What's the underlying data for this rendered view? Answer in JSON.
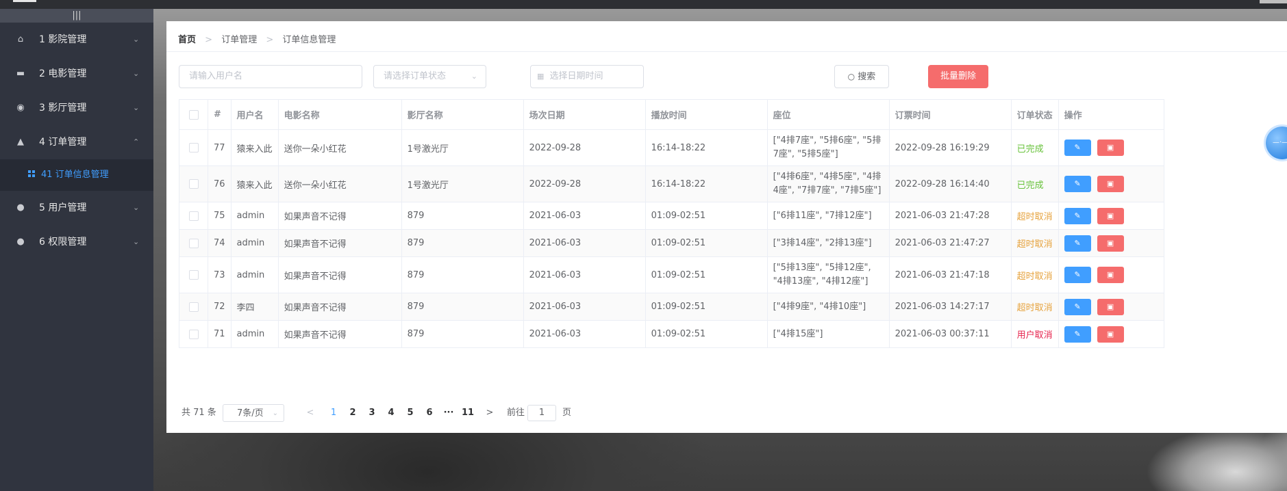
{
  "sidebar": {
    "collapse_icon": "|||",
    "items": [
      {
        "label": "1 影院管理",
        "icon": "home-icon",
        "glyph": "⌂",
        "chevron": "⌄"
      },
      {
        "label": "2 电影管理",
        "icon": "film-truck-icon",
        "glyph": "▬",
        "chevron": "⌄"
      },
      {
        "label": "3 影厅管理",
        "icon": "target-icon",
        "glyph": "◉",
        "chevron": "⌄"
      },
      {
        "label": "4 订单管理",
        "icon": "bell-icon",
        "glyph": "▲",
        "chevron": "⌃"
      },
      {
        "label": "5 用户管理",
        "icon": "user-icon",
        "glyph": "●",
        "chevron": "⌄"
      },
      {
        "label": "6 权限管理",
        "icon": "user-icon",
        "glyph": "●",
        "chevron": "⌄"
      }
    ],
    "submenu": {
      "label": "41 订单信息管理",
      "icon": "grid-icon"
    }
  },
  "breadcrumb": {
    "home": "首页",
    "sep": ">",
    "level1": "订单管理",
    "level2": "订单信息管理"
  },
  "filters": {
    "username_placeholder": "请输入用户名",
    "status_placeholder": "请选择订单状态",
    "date_placeholder": "选择日期时间",
    "search_label": "搜索",
    "batch_delete_label": "批量删除"
  },
  "table": {
    "headers": [
      "#",
      "用户名",
      "电影名称",
      "影厅名称",
      "场次日期",
      "播放时间",
      "座位",
      "订票时间",
      "订单状态",
      "操作"
    ],
    "rows": [
      {
        "id": "77",
        "user": "猿来入此",
        "movie": "送你一朵小红花",
        "hall": "1号激光厅",
        "date": "2022-09-28",
        "time": "16:14-18:22",
        "seats": "[\"4排7座\", \"5排6座\", \"5排7座\", \"5排5座\"]",
        "ordered": "2022-09-28 16:19:29",
        "status": "已完成",
        "status_color": "#67c23a"
      },
      {
        "id": "76",
        "user": "猿来入此",
        "movie": "送你一朵小红花",
        "hall": "1号激光厅",
        "date": "2022-09-28",
        "time": "16:14-18:22",
        "seats": "[\"4排6座\", \"4排5座\", \"4排4座\", \"7排7座\", \"7排5座\"]",
        "ordered": "2022-09-28 16:14:40",
        "status": "已完成",
        "status_color": "#67c23a"
      },
      {
        "id": "75",
        "user": "admin",
        "movie": "如果声音不记得",
        "hall": "879",
        "date": "2021-06-03",
        "time": "01:09-02:51",
        "seats": "[\"6排11座\", \"7排12座\"]",
        "ordered": "2021-06-03 21:47:28",
        "status": "超时取消",
        "status_color": "#e6a23c"
      },
      {
        "id": "74",
        "user": "admin",
        "movie": "如果声音不记得",
        "hall": "879",
        "date": "2021-06-03",
        "time": "01:09-02:51",
        "seats": "[\"3排14座\", \"2排13座\"]",
        "ordered": "2021-06-03 21:47:27",
        "status": "超时取消",
        "status_color": "#e6a23c"
      },
      {
        "id": "73",
        "user": "admin",
        "movie": "如果声音不记得",
        "hall": "879",
        "date": "2021-06-03",
        "time": "01:09-02:51",
        "seats": "[\"5排13座\", \"5排12座\", \"4排13座\", \"4排12座\"]",
        "ordered": "2021-06-03 21:47:18",
        "status": "超时取消",
        "status_color": "#e6a23c"
      },
      {
        "id": "72",
        "user": "李四",
        "movie": "如果声音不记得",
        "hall": "879",
        "date": "2021-06-03",
        "time": "01:09-02:51",
        "seats": "[\"4排9座\", \"4排10座\"]",
        "ordered": "2021-06-03 14:27:17",
        "status": "超时取消",
        "status_color": "#e6a23c"
      },
      {
        "id": "71",
        "user": "admin",
        "movie": "如果声音不记得",
        "hall": "879",
        "date": "2021-06-03",
        "time": "01:09-02:51",
        "seats": "[\"4排15座\"]",
        "ordered": "2021-06-03 00:37:11",
        "status": "用户取消",
        "status_color": "#e6224c"
      }
    ]
  },
  "pagination": {
    "total": "共 71 条",
    "page_size": "7条/页",
    "prev": "<",
    "next": ">",
    "pages": [
      "1",
      "2",
      "3",
      "4",
      "5",
      "6",
      "···",
      "11"
    ],
    "current": "1",
    "jump_prefix": "前往",
    "jump_value": "1",
    "jump_suffix": "页"
  }
}
